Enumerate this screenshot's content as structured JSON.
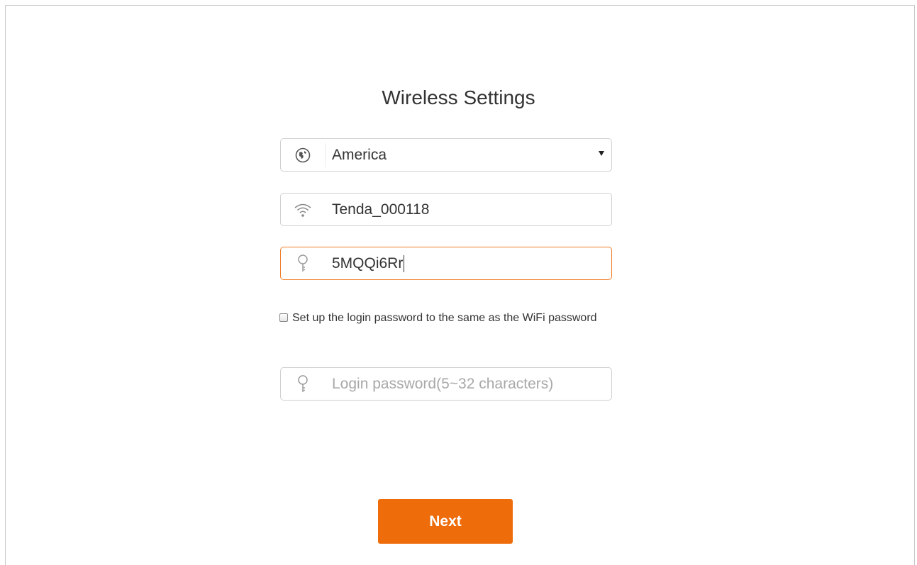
{
  "page": {
    "title": "Wireless Settings"
  },
  "region_select": {
    "icon": "globe-icon",
    "value": "America"
  },
  "ssid_input": {
    "icon": "wifi-icon",
    "value": "Tenda_000118"
  },
  "wifi_password_input": {
    "icon": "key-icon",
    "value": "5MQQi6Rr"
  },
  "same_password_checkbox": {
    "checked": false,
    "label": "Set up the login password to the same as the WiFi password"
  },
  "login_password_input": {
    "icon": "key-icon",
    "placeholder": "Login password(5~32 characters)",
    "value": ""
  },
  "next_button": {
    "label": "Next"
  },
  "colors": {
    "accent": "#ee6c0a",
    "focus_border": "#ef7d27",
    "text": "#333333",
    "placeholder": "#a8a8a8"
  }
}
